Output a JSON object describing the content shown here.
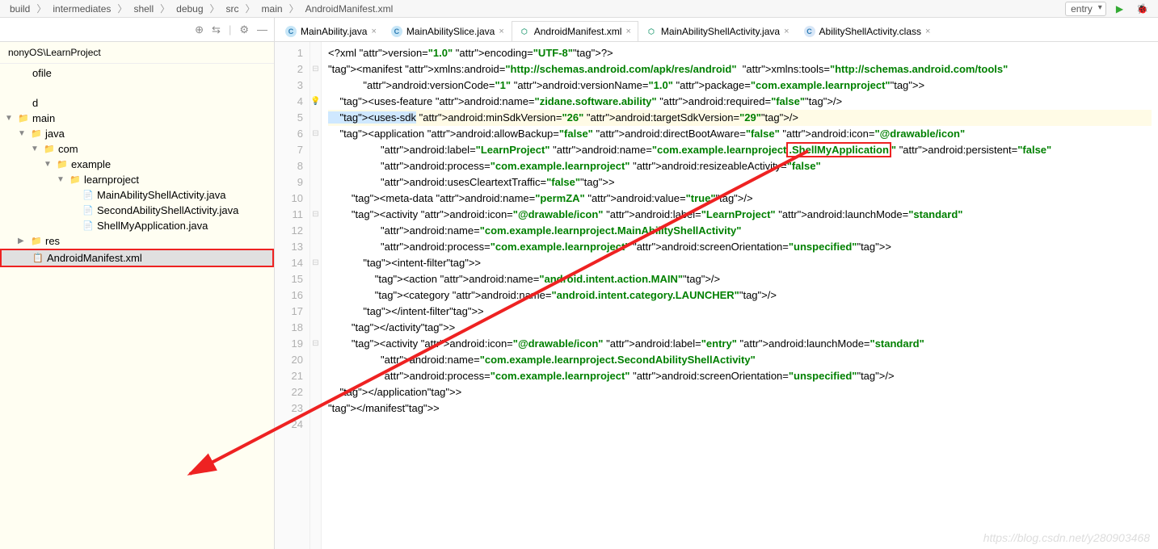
{
  "breadcrumb": [
    "build",
    "intermediates",
    "shell",
    "debug",
    "src",
    "main",
    "AndroidManifest.xml"
  ],
  "config_dropdown": "entry",
  "sidebar": {
    "path": "nonyOS\\LearnProject",
    "tree": [
      {
        "indent": 0,
        "caret": "",
        "icon": "",
        "label": "ofile"
      },
      {
        "indent": 0,
        "caret": "",
        "icon": "",
        "label": ""
      },
      {
        "indent": 0,
        "caret": "",
        "icon": "",
        "label": "d"
      },
      {
        "indent": 0,
        "caret": "▼",
        "icon": "folder-b",
        "label": "main"
      },
      {
        "indent": 1,
        "caret": "▼",
        "icon": "folder-b",
        "label": "java"
      },
      {
        "indent": 2,
        "caret": "▼",
        "icon": "folder-y",
        "label": "com"
      },
      {
        "indent": 3,
        "caret": "▼",
        "icon": "folder-y",
        "label": "example"
      },
      {
        "indent": 4,
        "caret": "▼",
        "icon": "folder-y",
        "label": "learnproject"
      },
      {
        "indent": 5,
        "caret": "",
        "icon": "jfile",
        "label": "MainAbilityShellActivity.java"
      },
      {
        "indent": 5,
        "caret": "",
        "icon": "jfile",
        "label": "SecondAbilityShellActivity.java"
      },
      {
        "indent": 5,
        "caret": "",
        "icon": "jfile",
        "label": "ShellMyApplication.java"
      },
      {
        "indent": 1,
        "caret": "▶",
        "icon": "folder-b",
        "label": "res"
      },
      {
        "indent": 1,
        "caret": "",
        "icon": "manifest",
        "label": "AndroidManifest.xml",
        "sel": true
      }
    ]
  },
  "tabs": [
    {
      "icon": "c",
      "label": "MainAbility.java",
      "active": false
    },
    {
      "icon": "c",
      "label": "MainAbilitySlice.java",
      "active": false
    },
    {
      "icon": "m",
      "label": "AndroidManifest.xml",
      "active": true
    },
    {
      "icon": "m",
      "label": "MainAbilityShellActivity.java",
      "active": false
    },
    {
      "icon": "cls",
      "label": "AbilityShellActivity.class",
      "active": false
    }
  ],
  "code": {
    "lines": [
      "<?xml version=\"1.0\" encoding=\"UTF-8\"?>",
      "<manifest xmlns:android=\"http://schemas.android.com/apk/res/android\"  xmlns:tools=\"http://schemas.android.com/tools\"",
      "            android:versionCode=\"1\" android:versionName=\"1.0\" package=\"com.example.learnproject\">",
      "    <uses-feature android:name=\"zidane.software.ability\" android:required=\"false\"/>",
      "    <uses-sdk android:minSdkVersion=\"26\" android:targetSdkVersion=\"29\"/>",
      "    <application android:allowBackup=\"false\" android:directBootAware=\"false\" android:icon=\"@drawable/icon\"",
      "                  android:label=\"LearnProject\" android:name=\"com.example.learnproject.ShellMyApplication\" android:persistent=\"false\"",
      "                  android:process=\"com.example.learnproject\" android:resizeableActivity=\"false\"",
      "                  android:usesCleartextTraffic=\"false\">",
      "        <meta-data android:name=\"permZA\" android:value=\"true\"/>",
      "        <activity android:icon=\"@drawable/icon\" android:label=\"LearnProject\" android:launchMode=\"standard\"",
      "                  android:name=\"com.example.learnproject.MainAbilityShellActivity\"",
      "                  android:process=\"com.example.learnproject\" android:screenOrientation=\"unspecified\">",
      "            <intent-filter>",
      "                <action android:name=\"android.intent.action.MAIN\"/>",
      "                <category android:name=\"android.intent.category.LAUNCHER\"/>",
      "            </intent-filter>",
      "        </activity>",
      "        <activity android:icon=\"@drawable/icon\" android:label=\"entry\" android:launchMode=\"standard\"",
      "                  android:name=\"com.example.learnproject.SecondAbilityShellActivity\"",
      "                  android:process=\"com.example.learnproject\" android:screenOrientation=\"unspecified\"/>",
      "    </application>",
      "</manifest>",
      ""
    ],
    "highlight_line": 5,
    "bulb_line": 4,
    "redbox_text": ".ShellMyApplication"
  },
  "watermark": "https://blog.csdn.net/y280903468"
}
